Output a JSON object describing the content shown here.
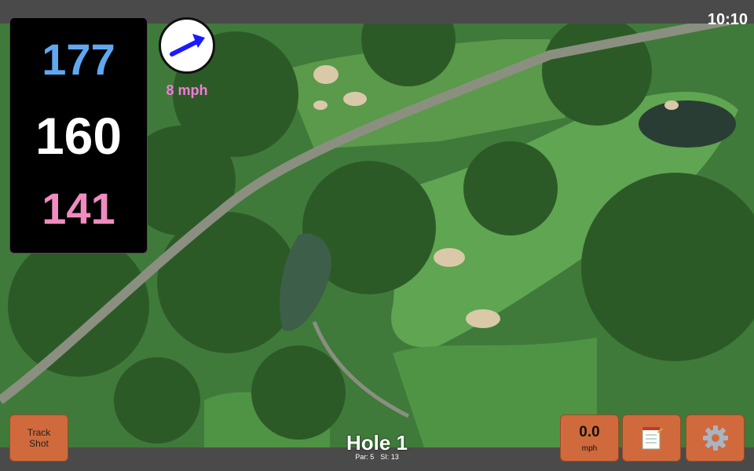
{
  "status": {
    "time": "10:10"
  },
  "distances": {
    "back": "177",
    "middle": "160",
    "front": "141"
  },
  "wind": {
    "speed": "8 mph",
    "icon": "wind-arrow-icon"
  },
  "hole": {
    "title": "Hole 1",
    "par": "Par: 5",
    "stroke_index": "SI: 13"
  },
  "buttons": {
    "track_shot_line1": "Track",
    "track_shot_line2": "Shot",
    "speed_value": "0.0",
    "speed_unit": "mph",
    "notes_icon": "notepad-icon",
    "settings_icon": "gear-icon"
  },
  "colors": {
    "accent_button": "#d06a3c",
    "back_distance": "#5fa8f0",
    "front_distance": "#f08cc0",
    "wind_text": "#f57bd8"
  }
}
